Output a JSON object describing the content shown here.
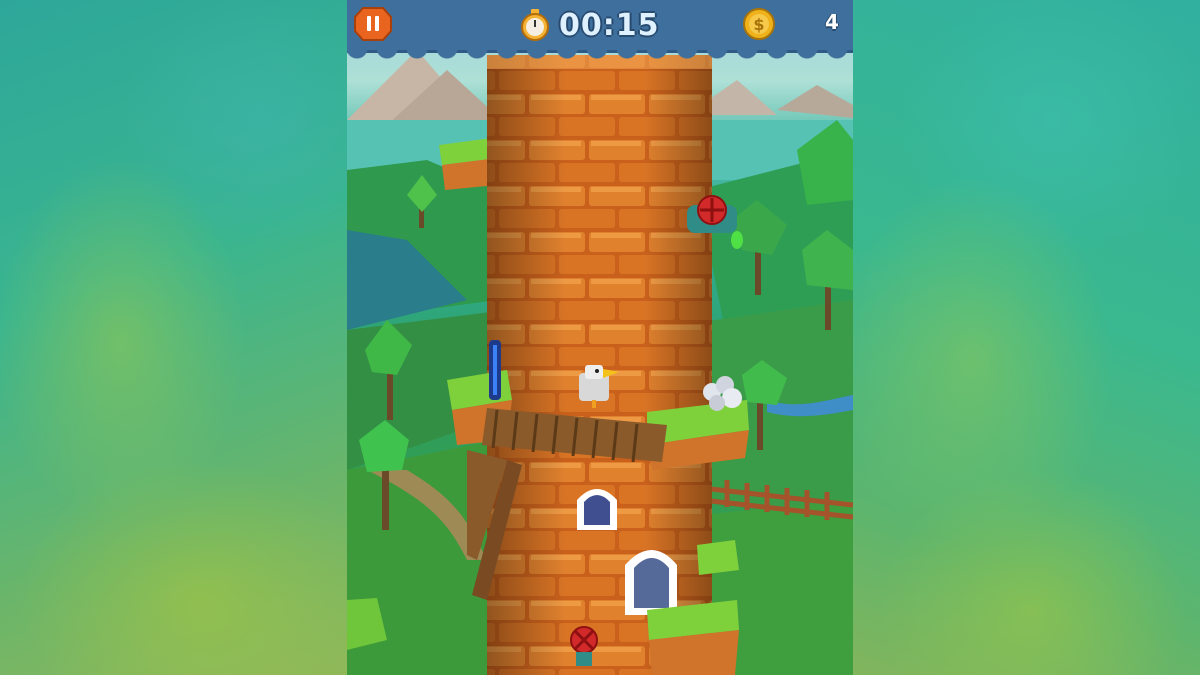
{
  "hud": {
    "timer": "00:15",
    "coin_count": "4",
    "icons": {
      "pause": "pause-icon",
      "timer": "stopwatch-icon",
      "coin": "coin-icon"
    }
  },
  "colors": {
    "hud_bar": "#3f6f9c",
    "pause_button": "#e8641f",
    "brick": "#e07a2a",
    "grass": "#7fd13b",
    "coin": "#f0b21b"
  }
}
